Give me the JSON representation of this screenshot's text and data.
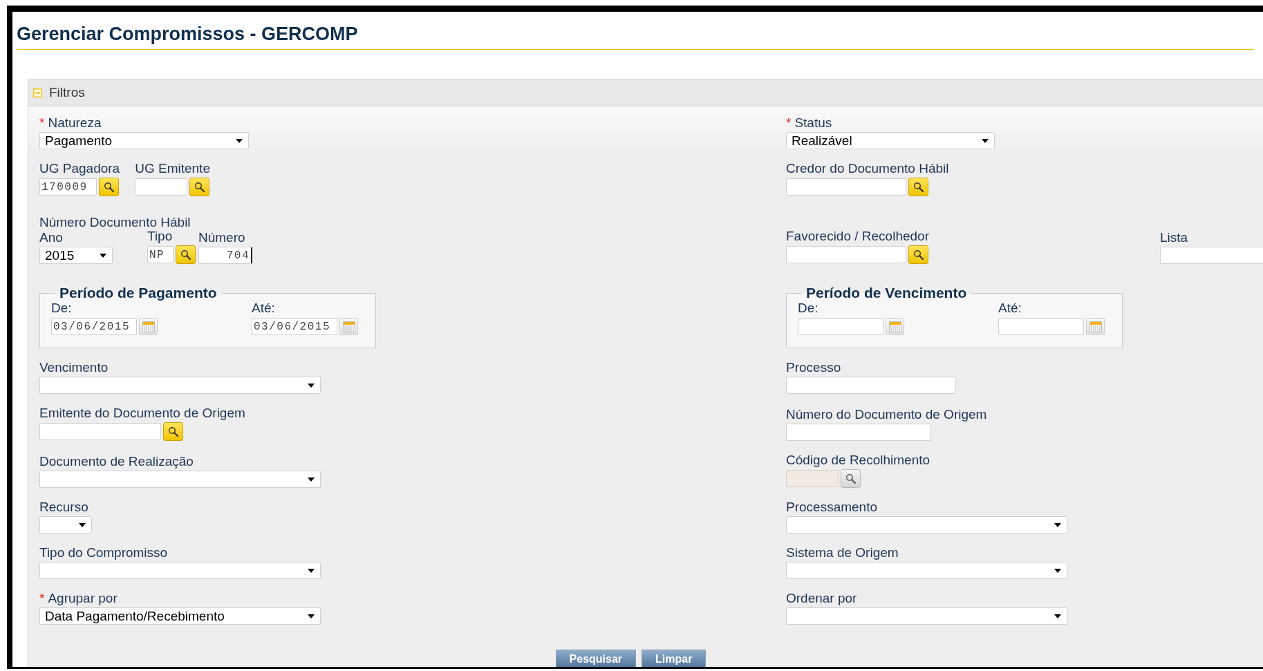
{
  "page": {
    "title": "Gerenciar Compromissos - GERCOMP"
  },
  "filters": {
    "title": "Filtros",
    "expanded": true,
    "rows": [
      {
        "left": [
          {
            "kind": "select",
            "label": "Natureza",
            "required_mark": "*",
            "value": "Pagamento"
          }
        ],
        "right": [
          {
            "kind": "select",
            "label": "Status",
            "required_mark": "*",
            "value": "Realizável"
          }
        ]
      },
      {
        "left": [
          {
            "kind": "lookup",
            "label": "UG Pagadora",
            "value": "170009"
          },
          {
            "kind": "lookup",
            "label": "UG Emitente"
          }
        ],
        "right": [
          {
            "kind": "lookup",
            "label": "Credor do Documento Hábil"
          }
        ]
      },
      {
        "left": [
          {
            "kind": "group",
            "label": "Número Documento Hábil",
            "fields": [
              {
                "kind": "select",
                "label": "Ano",
                "value": "2015"
              },
              {
                "kind": "lookup",
                "label": "Tipo",
                "value": "NP"
              },
              {
                "kind": "number",
                "label": "Número",
                "value": "704"
              }
            ]
          }
        ],
        "right": [
          {
            "kind": "lookup",
            "label": "Favorecido / Recolhedor"
          },
          {
            "kind": "text",
            "label": "Lista"
          }
        ]
      },
      {
        "left": [
          {
            "kind": "period",
            "label": "Período de Pagamento",
            "from_label": "De:",
            "from": "03/06/2015",
            "to_label": "Até:",
            "to": "03/06/2015"
          }
        ],
        "right": [
          {
            "kind": "period",
            "label": "Período de Vencimento",
            "from_label": "De:",
            "to_label": "Até:"
          }
        ]
      },
      {
        "left": [
          {
            "kind": "select",
            "label": "Vencimento"
          }
        ],
        "right": [
          {
            "kind": "text",
            "label": "Processo"
          }
        ]
      },
      {
        "left": [
          {
            "kind": "lookup",
            "label": "Emitente do Documento de Origem"
          }
        ],
        "right": [
          {
            "kind": "text",
            "label": "Número do Documento de Origem"
          }
        ]
      },
      {
        "left": [
          {
            "kind": "select",
            "label": "Documento de Realização"
          }
        ],
        "right": [
          {
            "kind": "lookup",
            "label": "Código de Recolhimento",
            "disabled": true
          }
        ]
      },
      {
        "left": [
          {
            "kind": "select",
            "label": "Recurso"
          }
        ],
        "right": [
          {
            "kind": "select",
            "label": "Processamento"
          }
        ]
      },
      {
        "left": [
          {
            "kind": "select",
            "label": "Tipo do Compromisso"
          }
        ],
        "right": [
          {
            "kind": "select",
            "label": "Sistema de Origem"
          }
        ]
      },
      {
        "left": [
          {
            "kind": "select",
            "label": "Agrupar por",
            "required_mark": "*",
            "value": "Data Pagamento/Recebimento"
          }
        ],
        "right": [
          {
            "kind": "select",
            "label": "Ordenar por"
          }
        ]
      }
    ]
  },
  "buttons": [
    "Pesquisar",
    "Limpar"
  ]
}
